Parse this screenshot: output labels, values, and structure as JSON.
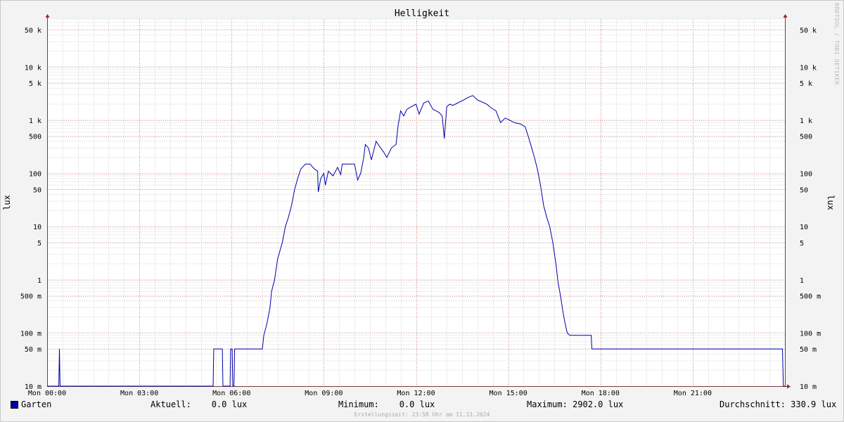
{
  "chart_data": {
    "type": "line",
    "title": "Helligkeit",
    "ylabel": "lux",
    "ylabel_right": "lux",
    "yscale": "log",
    "ylim": [
      0.01,
      80000
    ],
    "xlim_hours": [
      0,
      24
    ],
    "grid": true,
    "x_ticks": [
      {
        "h": 0,
        "label": "Mon 00:00"
      },
      {
        "h": 3,
        "label": "Mon 03:00"
      },
      {
        "h": 6,
        "label": "Mon 06:00"
      },
      {
        "h": 9,
        "label": "Mon 09:00"
      },
      {
        "h": 12,
        "label": "Mon 12:00"
      },
      {
        "h": 15,
        "label": "Mon 15:00"
      },
      {
        "h": 18,
        "label": "Mon 18:00"
      },
      {
        "h": 21,
        "label": "Mon 21:00"
      }
    ],
    "y_ticks": [
      {
        "v": 0.01,
        "label": "10 m"
      },
      {
        "v": 0.05,
        "label": "50 m"
      },
      {
        "v": 0.1,
        "label": "100 m"
      },
      {
        "v": 0.5,
        "label": "500 m"
      },
      {
        "v": 1,
        "label": "1"
      },
      {
        "v": 5,
        "label": "5"
      },
      {
        "v": 10,
        "label": "10"
      },
      {
        "v": 50,
        "label": "50"
      },
      {
        "v": 100,
        "label": "100"
      },
      {
        "v": 500,
        "label": "500"
      },
      {
        "v": 1000,
        "label": "1 k"
      },
      {
        "v": 5000,
        "label": "5 k"
      },
      {
        "v": 10000,
        "label": "10 k"
      },
      {
        "v": 50000,
        "label": "50 k"
      }
    ],
    "series": [
      {
        "name": "Garten",
        "color": "#0000aa",
        "points": [
          [
            0,
            0.01
          ],
          [
            0.38,
            0.01
          ],
          [
            0.4,
            0.05
          ],
          [
            0.42,
            0.01
          ],
          [
            5.4,
            0.01
          ],
          [
            5.42,
            0.05
          ],
          [
            5.7,
            0.05
          ],
          [
            5.72,
            0.01
          ],
          [
            5.95,
            0.01
          ],
          [
            5.97,
            0.05
          ],
          [
            6.02,
            0.05
          ],
          [
            6.04,
            0.01
          ],
          [
            6.08,
            0.01
          ],
          [
            6.1,
            0.05
          ],
          [
            7.0,
            0.05
          ],
          [
            7.05,
            0.09
          ],
          [
            7.15,
            0.15
          ],
          [
            7.25,
            0.3
          ],
          [
            7.3,
            0.6
          ],
          [
            7.4,
            1.0
          ],
          [
            7.5,
            2.5
          ],
          [
            7.65,
            5
          ],
          [
            7.75,
            10
          ],
          [
            7.85,
            15
          ],
          [
            7.95,
            25
          ],
          [
            8.05,
            50
          ],
          [
            8.15,
            80
          ],
          [
            8.25,
            120
          ],
          [
            8.4,
            150
          ],
          [
            8.55,
            150
          ],
          [
            8.7,
            120
          ],
          [
            8.8,
            110
          ],
          [
            8.82,
            45
          ],
          [
            8.9,
            80
          ],
          [
            9.0,
            100
          ],
          [
            9.05,
            60
          ],
          [
            9.15,
            110
          ],
          [
            9.3,
            90
          ],
          [
            9.45,
            130
          ],
          [
            9.55,
            95
          ],
          [
            9.6,
            150
          ],
          [
            9.8,
            150
          ],
          [
            10.0,
            150
          ],
          [
            10.1,
            75
          ],
          [
            10.2,
            100
          ],
          [
            10.3,
            200
          ],
          [
            10.35,
            350
          ],
          [
            10.45,
            300
          ],
          [
            10.55,
            180
          ],
          [
            10.7,
            400
          ],
          [
            10.85,
            300
          ],
          [
            10.95,
            250
          ],
          [
            11.05,
            200
          ],
          [
            11.2,
            300
          ],
          [
            11.35,
            350
          ],
          [
            11.42,
            800
          ],
          [
            11.5,
            1500
          ],
          [
            11.6,
            1200
          ],
          [
            11.7,
            1600
          ],
          [
            11.85,
            1800
          ],
          [
            12.0,
            2000
          ],
          [
            12.1,
            1300
          ],
          [
            12.25,
            2100
          ],
          [
            12.4,
            2300
          ],
          [
            12.55,
            1600
          ],
          [
            12.65,
            1500
          ],
          [
            12.75,
            1400
          ],
          [
            12.85,
            1200
          ],
          [
            12.92,
            450
          ],
          [
            13.0,
            1800
          ],
          [
            13.1,
            2000
          ],
          [
            13.2,
            1900
          ],
          [
            13.35,
            2100
          ],
          [
            13.55,
            2400
          ],
          [
            13.7,
            2700
          ],
          [
            13.85,
            2900
          ],
          [
            14.0,
            2400
          ],
          [
            14.15,
            2200
          ],
          [
            14.3,
            2000
          ],
          [
            14.45,
            1700
          ],
          [
            14.6,
            1500
          ],
          [
            14.75,
            900
          ],
          [
            14.9,
            1100
          ],
          [
            15.05,
            1000
          ],
          [
            15.2,
            900
          ],
          [
            15.4,
            850
          ],
          [
            15.55,
            750
          ],
          [
            15.65,
            500
          ],
          [
            15.75,
            320
          ],
          [
            15.85,
            200
          ],
          [
            15.95,
            120
          ],
          [
            16.05,
            60
          ],
          [
            16.15,
            25
          ],
          [
            16.25,
            15
          ],
          [
            16.35,
            10
          ],
          [
            16.45,
            5
          ],
          [
            16.55,
            2
          ],
          [
            16.62,
            0.9
          ],
          [
            16.7,
            0.5
          ],
          [
            16.78,
            0.25
          ],
          [
            16.85,
            0.15
          ],
          [
            16.92,
            0.1
          ],
          [
            17.0,
            0.09
          ],
          [
            17.7,
            0.09
          ],
          [
            17.72,
            0.05
          ],
          [
            23.92,
            0.05
          ],
          [
            23.95,
            0.01
          ],
          [
            24,
            0.01
          ]
        ]
      }
    ]
  },
  "legend": {
    "series_name": "Garten",
    "aktuell": "Aktuell:    0.0 lux",
    "minimum": "Minimum:    0.0 lux",
    "maximum": "Maximum: 2902.0 lux",
    "durchschnitt": "Durchschnitt: 330.9 lux"
  },
  "footer": "Erstellungszeit: 23:58 Uhr am 11.11.2024",
  "watermark": "RRDTOOL / TOBI OETIKER"
}
